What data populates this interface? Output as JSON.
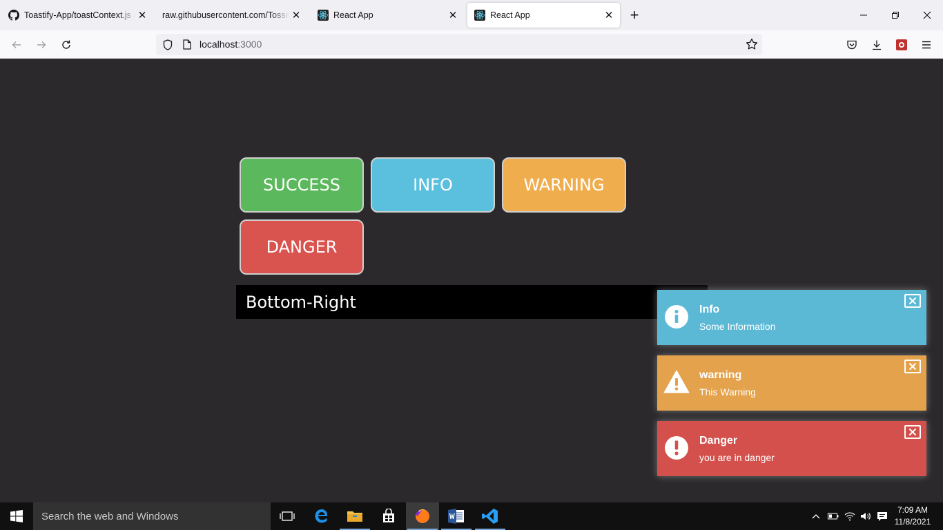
{
  "browser": {
    "tabs": [
      {
        "title": "Toastify-App/toastContext.js at",
        "active": false
      },
      {
        "title": "raw.githubusercontent.com/Tossma",
        "active": false
      },
      {
        "title": "React App",
        "active": false
      },
      {
        "title": "React App",
        "active": true
      }
    ],
    "url_host": "localhost",
    "url_port": ":3000"
  },
  "page": {
    "buttons": {
      "success": "SUCCESS",
      "info": "INFO",
      "warning": "WARNING",
      "danger": "DANGER"
    },
    "position_select": "Bottom-Right",
    "toasts": [
      {
        "title": "Info",
        "description": "Some Information",
        "color": "#5bb9d6"
      },
      {
        "title": "warning",
        "description": "This Warning",
        "color": "#e3a24b"
      },
      {
        "title": "Danger",
        "description": "you are in danger",
        "color": "#d4504c"
      }
    ]
  },
  "colors": {
    "success": "#5cb85c",
    "info": "#5bc0de",
    "warning": "#f0ad4e",
    "danger": "#d9534f",
    "page_bg": "#2b292b"
  },
  "taskbar": {
    "search_placeholder": "Search the web and Windows",
    "time": "7:09 AM",
    "date": "11/8/2021"
  }
}
